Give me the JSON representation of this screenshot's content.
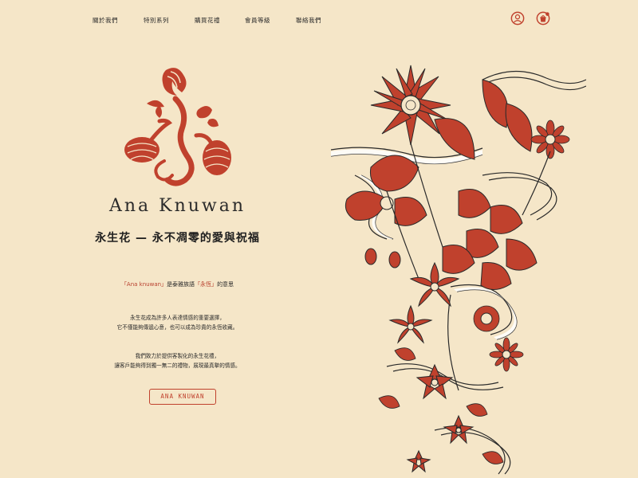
{
  "nav": {
    "items": [
      "關於我們",
      "特別系列",
      "購買花禮",
      "會員等級",
      "聯絡我們"
    ]
  },
  "icons": {
    "account": "user-icon",
    "cart": "shopping-bag-icon"
  },
  "hero": {
    "brand": "Ana Knuwan",
    "tagline": "永生花 — 永不凋零的愛與祝福",
    "meaning_prefix": "「Ana knuwan」",
    "meaning_mid": "是泰雅族語",
    "meaning_hl": "「永恆」",
    "meaning_suffix": "的意思",
    "para1_line1": "永生花成為許多人表達情感的重要選擇，",
    "para1_line2": "它不僅能夠傳遞心意，也可以成為珍貴的永恆收藏。",
    "para2_line1": "我們致力於提供客製化的永生花禮，",
    "para2_line2": "讓客戶能夠得到獨一無二的禮物，展現最真摯的情感。",
    "cta": "ANA KNUWAN"
  },
  "colors": {
    "background": "#f5e6c8",
    "accent": "#c0412d",
    "text": "#222222"
  }
}
